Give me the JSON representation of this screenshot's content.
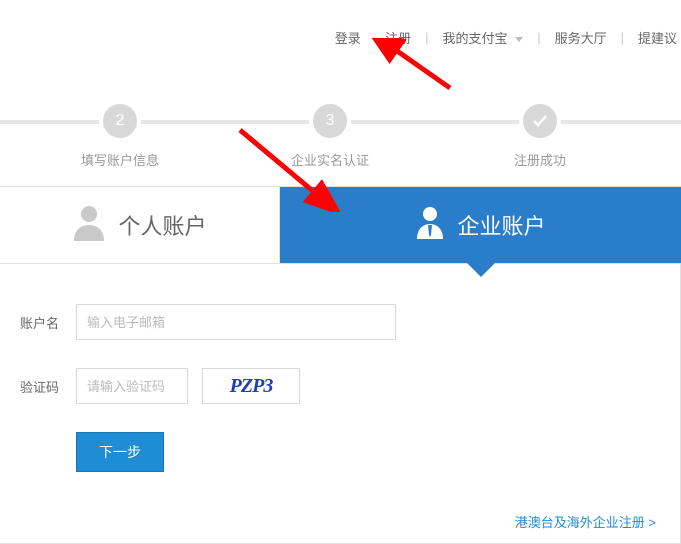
{
  "topnav": {
    "login": "登录",
    "register": "注册",
    "myalipay": "我的支付宝",
    "service": "服务大厅",
    "feedback": "提建议"
  },
  "steps": {
    "s2_num": "2",
    "s2_label": "填写账户信息",
    "s3_num": "3",
    "s3_label": "企业实名认证",
    "s4_label": "注册成功"
  },
  "tabs": {
    "personal": "个人账户",
    "enterprise": "企业账户"
  },
  "form": {
    "account_label": "账户名",
    "account_placeholder": "输入电子邮箱",
    "captcha_label": "验证码",
    "captcha_placeholder": "请输入验证码",
    "captcha_text": "PZP3",
    "next": "下一步"
  },
  "bottom_link": "港澳台及海外企业注册 >"
}
